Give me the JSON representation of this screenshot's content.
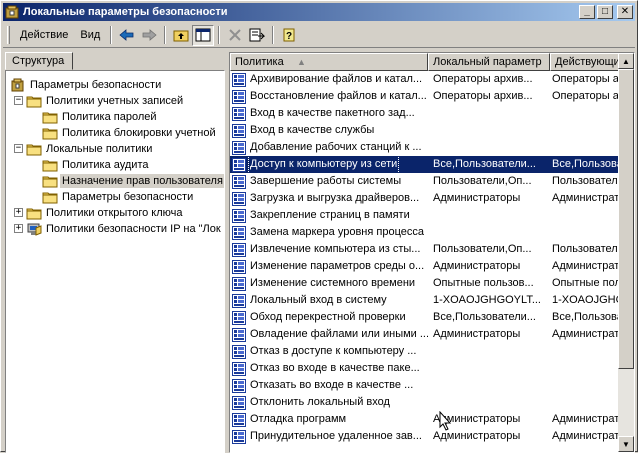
{
  "window": {
    "title": "Локальные параметры безопасности",
    "minimize_label": "_",
    "maximize_label": "□",
    "close_label": "✕"
  },
  "menu": {
    "action": "Действие",
    "view": "Вид"
  },
  "left_tab": "Структура",
  "tree": [
    {
      "label": "Параметры безопасности"
    },
    {
      "label": "Политики учетных записей",
      "expander": "−"
    },
    {
      "label": "Политика паролей"
    },
    {
      "label": "Политика блокировки учетной"
    },
    {
      "label": "Локальные политики",
      "expander": "−"
    },
    {
      "label": "Политика аудита"
    },
    {
      "label": "Назначение прав пользователя"
    },
    {
      "label": "Параметры безопасности"
    },
    {
      "label": "Политики открытого ключа",
      "expander": "+"
    },
    {
      "label": "Политики безопасности IP на \"Лок",
      "expander": "+"
    }
  ],
  "columns": {
    "policy": "Политика",
    "local": "Локальный параметр",
    "effective": "Действующи"
  },
  "rows": [
    {
      "policy": "Архивирование файлов и катал...",
      "local": "Операторы архив...",
      "effective": "Операторы ар"
    },
    {
      "policy": "Восстановление файлов и катал...",
      "local": "Операторы архив...",
      "effective": "Операторы ар"
    },
    {
      "policy": "Вход в качестве пакетного зад...",
      "local": "",
      "effective": ""
    },
    {
      "policy": "Вход в качестве службы",
      "local": "",
      "effective": ""
    },
    {
      "policy": "Добавление рабочих станций к ...",
      "local": "",
      "effective": ""
    },
    {
      "policy": "Доступ к компьютеру из сети",
      "local": "Все,Пользователи...",
      "effective": "Все,Пользова"
    },
    {
      "policy": "Завершение работы системы",
      "local": "Пользователи,Оп...",
      "effective": "Пользователи"
    },
    {
      "policy": "Загрузка и выгрузка драйверов...",
      "local": "Администраторы",
      "effective": "Администрато"
    },
    {
      "policy": "Закрепление страниц в памяти",
      "local": "",
      "effective": ""
    },
    {
      "policy": "Замена маркера уровня процесса",
      "local": "",
      "effective": ""
    },
    {
      "policy": "Извлечение компьютера из сты...",
      "local": "Пользователи,Оп...",
      "effective": "Пользователи"
    },
    {
      "policy": "Изменение параметров среды о...",
      "local": "Администраторы",
      "effective": "Администрато"
    },
    {
      "policy": "Изменение системного времени",
      "local": "Опытные пользов...",
      "effective": "Опытные поль"
    },
    {
      "policy": "Локальный вход в систему",
      "local": "1-XOAOJGHGOYLT...",
      "effective": "1-XOAOJGHG"
    },
    {
      "policy": "Обход перекрестной проверки",
      "local": "Все,Пользователи...",
      "effective": "Все,Пользова"
    },
    {
      "policy": "Овладение файлами или иными ...",
      "local": "Администраторы",
      "effective": "Администрато"
    },
    {
      "policy": "Отказ в доступе к компьютеру ...",
      "local": "",
      "effective": ""
    },
    {
      "policy": "Отказ во входе в качестве паке...",
      "local": "",
      "effective": ""
    },
    {
      "policy": "Отказать во входе в качестве ...",
      "local": "",
      "effective": ""
    },
    {
      "policy": "Отклонить локальный вход",
      "local": "",
      "effective": ""
    },
    {
      "policy": "Отладка программ",
      "local": "Администраторы",
      "effective": "Администрато"
    },
    {
      "policy": "Принудительное удаленное зав...",
      "local": "Администраторы",
      "effective": "Администрато"
    }
  ],
  "icons": {
    "policy_row": "policy-icon",
    "tree_root": "security-settings-icon",
    "folder": "folder-icon",
    "ip_security": "ip-security-icon"
  },
  "colors": {
    "title_start": "#0a246a",
    "title_end": "#a6caf0",
    "selection": "#0a246a",
    "face": "#d4d0c8"
  }
}
